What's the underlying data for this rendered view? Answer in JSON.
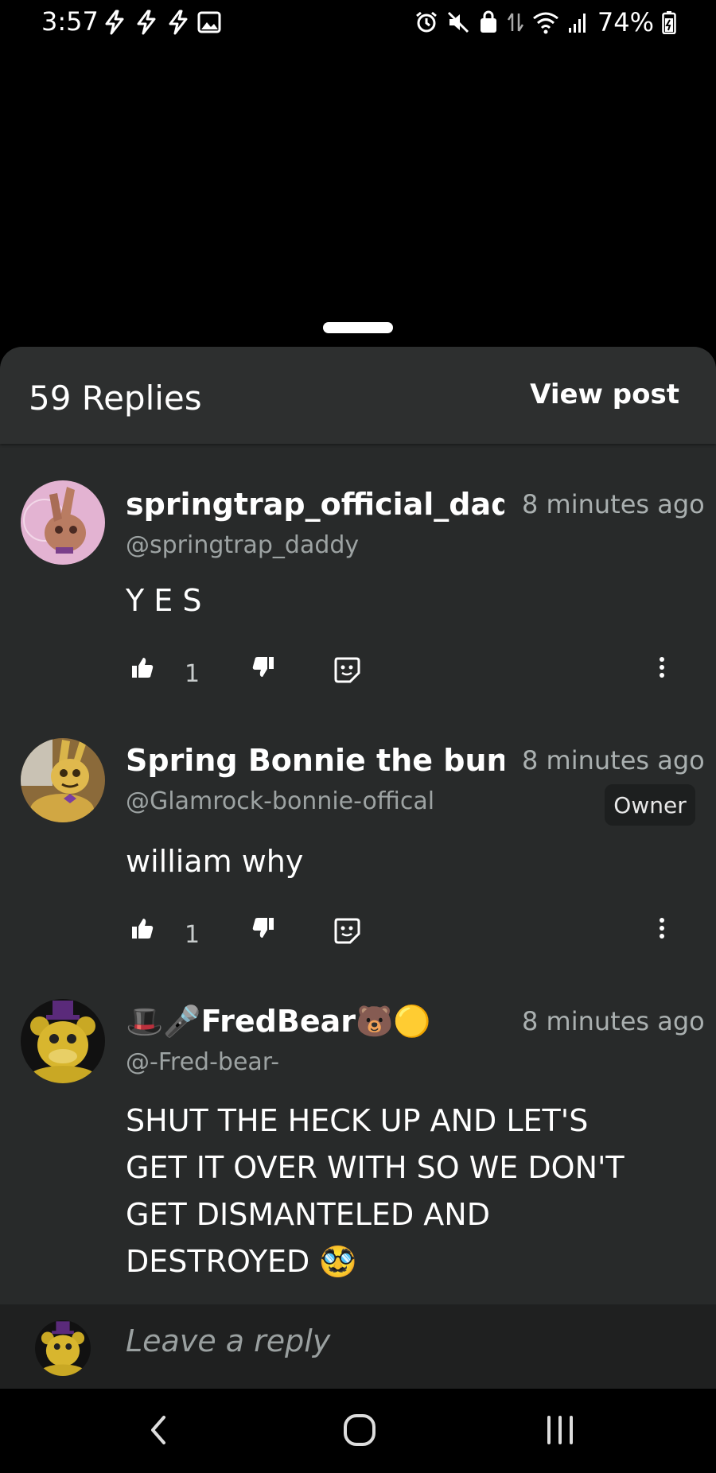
{
  "status_bar": {
    "time": "3:57",
    "battery": "74%",
    "left_icons": [
      "flash-icon",
      "flash-icon",
      "flash-icon",
      "image-icon"
    ],
    "right_icons": [
      "alarm-icon",
      "mute-icon",
      "secure-folder-icon",
      "data-arrows-icon",
      "wifi-icon",
      "signal-icon",
      "battery-icon"
    ]
  },
  "header": {
    "replies_count": "59 Replies",
    "view_post": "View post"
  },
  "comments": [
    {
      "username": "springtrap_official_daddy",
      "handle": "@springtrap_daddy",
      "timestamp": "8 minutes ago",
      "body": "Y E S",
      "likes": "1",
      "badge": ""
    },
    {
      "username": "Spring Bonnie the bunny",
      "handle": "@Glamrock-bonnie-offical",
      "timestamp": "8 minutes ago",
      "body": "william why",
      "likes": "1",
      "badge": "Owner"
    },
    {
      "username": "🎩🎤FredBear🐻🟡",
      "handle": "@-Fred-bear-",
      "timestamp": "8 minutes ago",
      "body_lines": [
        "SHUT THE HECK UP AND LET'S",
        "GET IT OVER WITH SO WE DON'T",
        "GET DISMANTELED AND",
        "DESTROYED 🥸"
      ],
      "likes": "",
      "badge": ""
    }
  ],
  "reply_bar": {
    "placeholder": "Leave a reply"
  },
  "nav": {
    "icons": [
      "back-icon",
      "home-icon",
      "recents-icon"
    ]
  },
  "colors": {
    "sheet_bg": "#282a2a",
    "header_bg": "#2d2f2f",
    "muted_text": "#aab0b0",
    "badge_bg": "#1d1f1f"
  }
}
